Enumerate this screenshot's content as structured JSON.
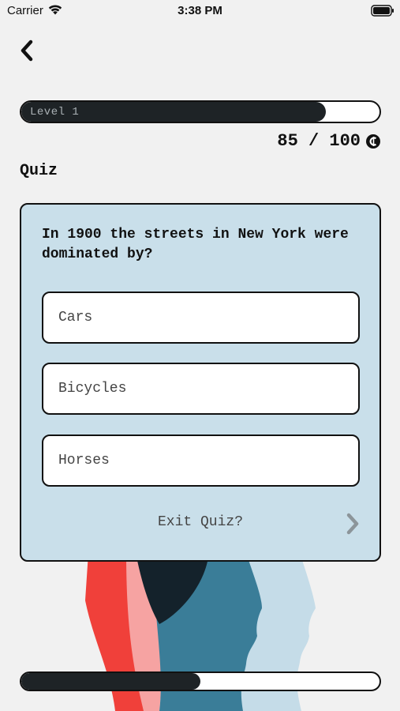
{
  "status_bar": {
    "carrier": "Carrier",
    "time": "3:38 PM",
    "icons": [
      "wifi-icon",
      "battery-icon"
    ]
  },
  "header": {
    "back_icon": "chevron-left-icon",
    "level_label": "Level 1",
    "level_progress": 0.85,
    "score_text": "85 / 100",
    "coin_icon": "coin-icon",
    "title": "Quiz"
  },
  "quiz": {
    "question": "In 1900 the streets in New York were dominated by?",
    "answers": [
      "Cars",
      "Bicycles",
      "Horses"
    ],
    "exit_label": "Exit Quiz?",
    "next_icon": "chevron-right-icon"
  },
  "footer": {
    "quiz_progress": 0.5
  },
  "colors": {
    "background": "#f1f1f1",
    "card": "#c9dfea",
    "bar_fill": "#1e2326",
    "illustration_red": "#f0403a",
    "illustration_pink": "#f6a3a2",
    "illustration_navy": "#14222b",
    "illustration_teal": "#3a7d98",
    "illustration_lightblue": "#c5dce8"
  }
}
